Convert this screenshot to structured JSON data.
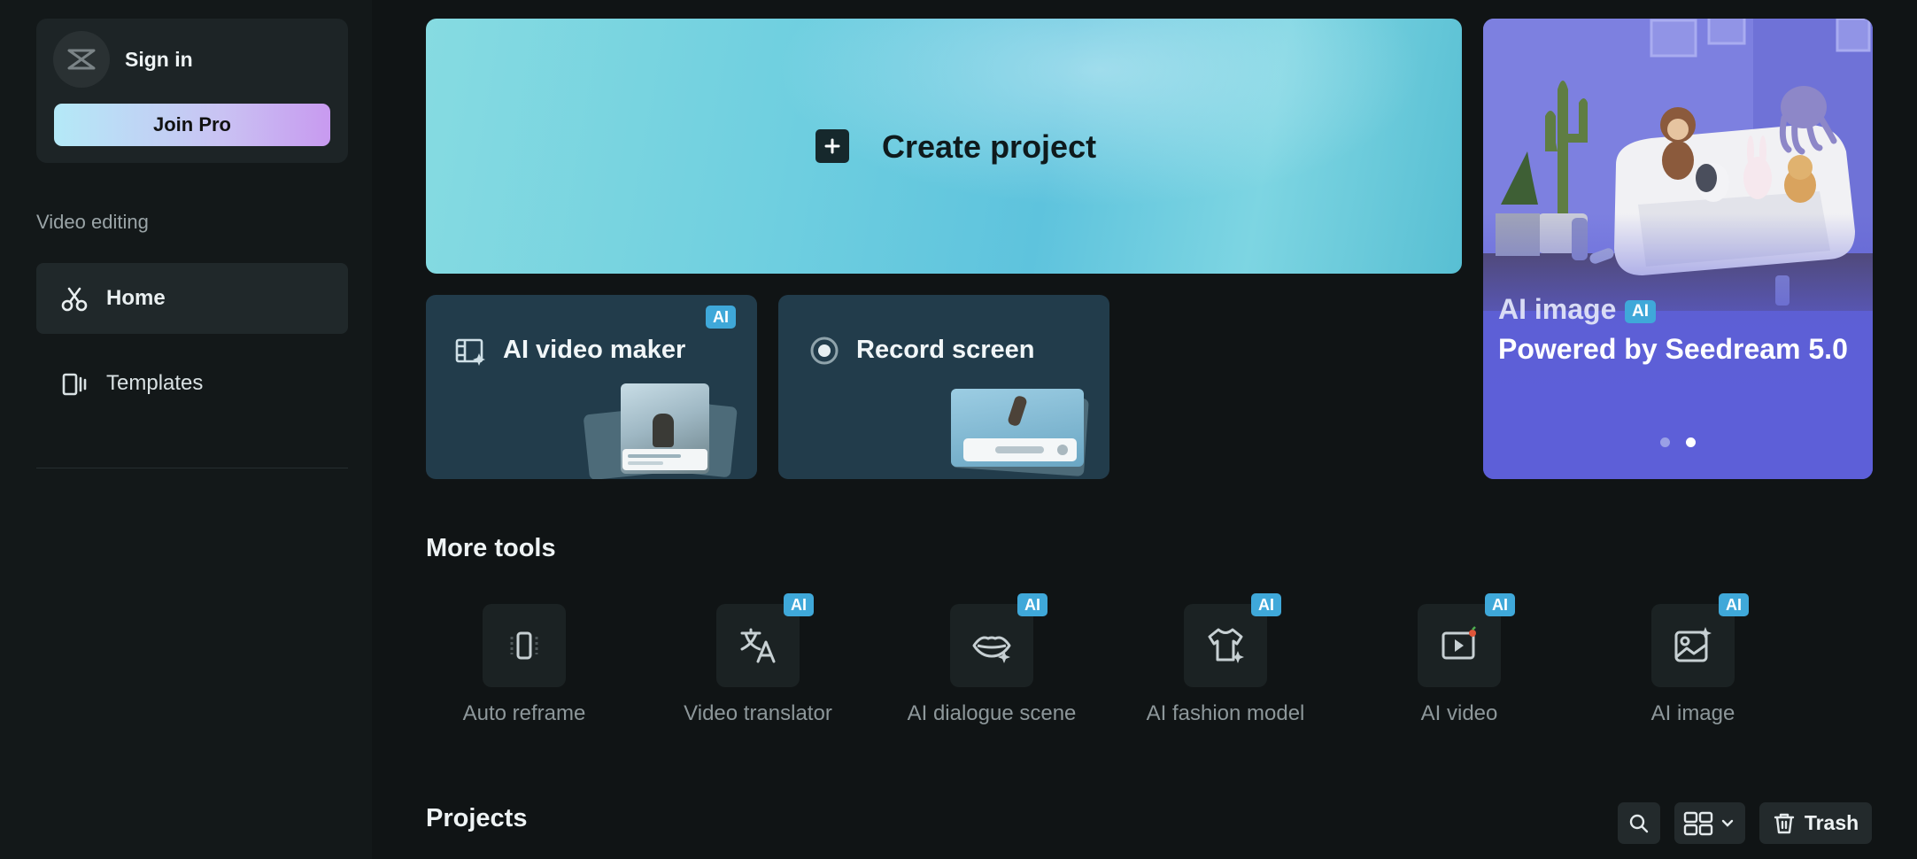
{
  "sidebar": {
    "signin_label": "Sign in",
    "join_pro_label": "Join Pro",
    "section_label": "Video editing",
    "items": [
      {
        "label": "Home",
        "icon": "scissors-icon",
        "active": true
      },
      {
        "label": "Templates",
        "icon": "templates-icon",
        "active": false
      }
    ]
  },
  "create": {
    "label": "Create project",
    "icon": "plus-icon"
  },
  "quick_tools": [
    {
      "label": "AI video maker",
      "badge": "AI",
      "icon": "film-sparkle-icon"
    },
    {
      "label": "Record screen",
      "icon": "record-icon"
    }
  ],
  "promo": {
    "title": "AI image",
    "badge": "AI",
    "subtitle": "Powered by Seedream 5.0",
    "active_slide": 2,
    "slide_count": 2
  },
  "more_tools": {
    "heading": "More tools",
    "items": [
      {
        "label": "Auto reframe",
        "icon": "reframe-icon",
        "badge": ""
      },
      {
        "label": "Video translator",
        "icon": "translate-icon",
        "badge": "AI"
      },
      {
        "label": "AI dialogue scene",
        "icon": "lips-icon",
        "badge": "AI"
      },
      {
        "label": "AI fashion model",
        "icon": "shirt-icon",
        "badge": "AI"
      },
      {
        "label": "AI video",
        "icon": "video-play-icon",
        "badge": "AI"
      },
      {
        "label": "AI image",
        "icon": "image-sparkle-icon",
        "badge": "AI"
      }
    ]
  },
  "projects": {
    "heading": "Projects",
    "trash_label": "Trash",
    "search_icon": "search-icon",
    "view_icon": "grid-view-icon"
  },
  "colors": {
    "background": "#101415",
    "accent_badge": "#3fa8d9",
    "create_card": "#6fcfe0",
    "promo": "#6b6fd6"
  }
}
